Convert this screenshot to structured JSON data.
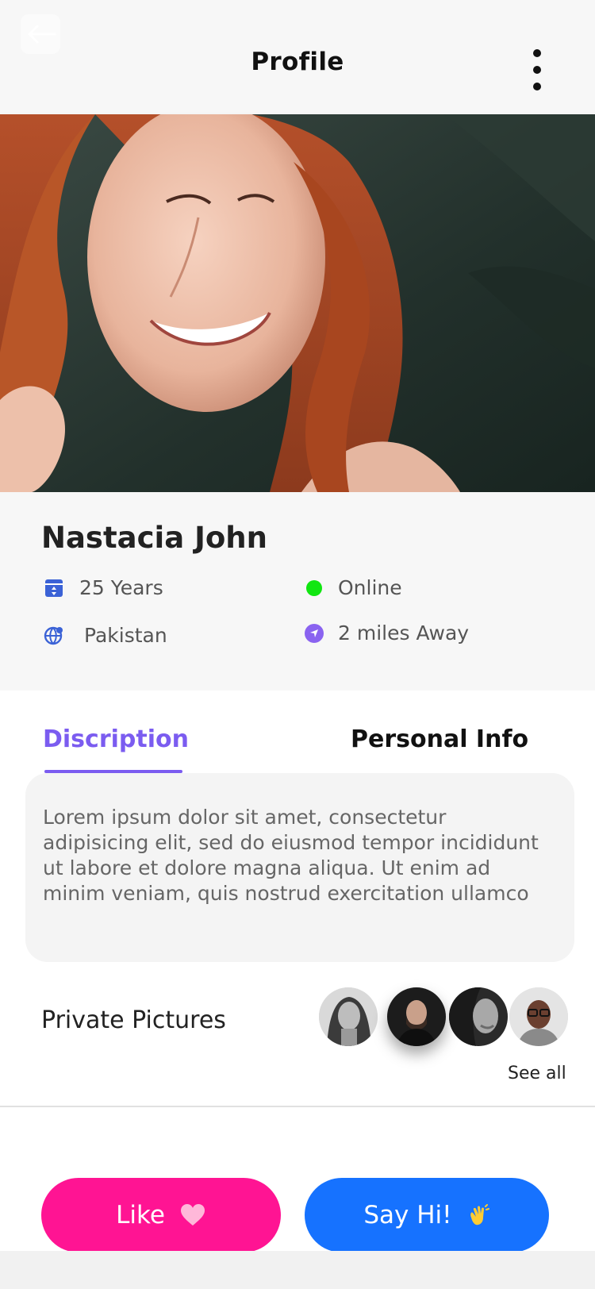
{
  "header": {
    "title": "Profile",
    "back_icon": "arrow-left-icon",
    "menu_icon": "more-vertical-icon"
  },
  "profile": {
    "name": "Nastacia John",
    "age": "25 Years",
    "status": "Online",
    "country": "Pakistan",
    "distance": "2 miles Away",
    "status_color": "#11e611"
  },
  "tabs": [
    {
      "label": "Discription",
      "active": true
    },
    {
      "label": "Personal Info",
      "active": false
    }
  ],
  "description": "Lorem ipsum dolor sit amet, consectetur adipisicing elit, sed do eiusmod tempor incididunt ut labore et dolore magna aliqua. Ut enim ad minim veniam, quis nostrud exercitation ullamco",
  "private_pictures": {
    "label": "Private Pictures",
    "see_all": "See all"
  },
  "actions": {
    "like_label": "Like",
    "like_icon": "heart-icon",
    "hi_label": "Say Hi!",
    "hi_icon": "waving-hand-icon"
  },
  "colors": {
    "accent": "#7b5cf0",
    "like": "#ff1493",
    "hi": "#1672ff"
  }
}
